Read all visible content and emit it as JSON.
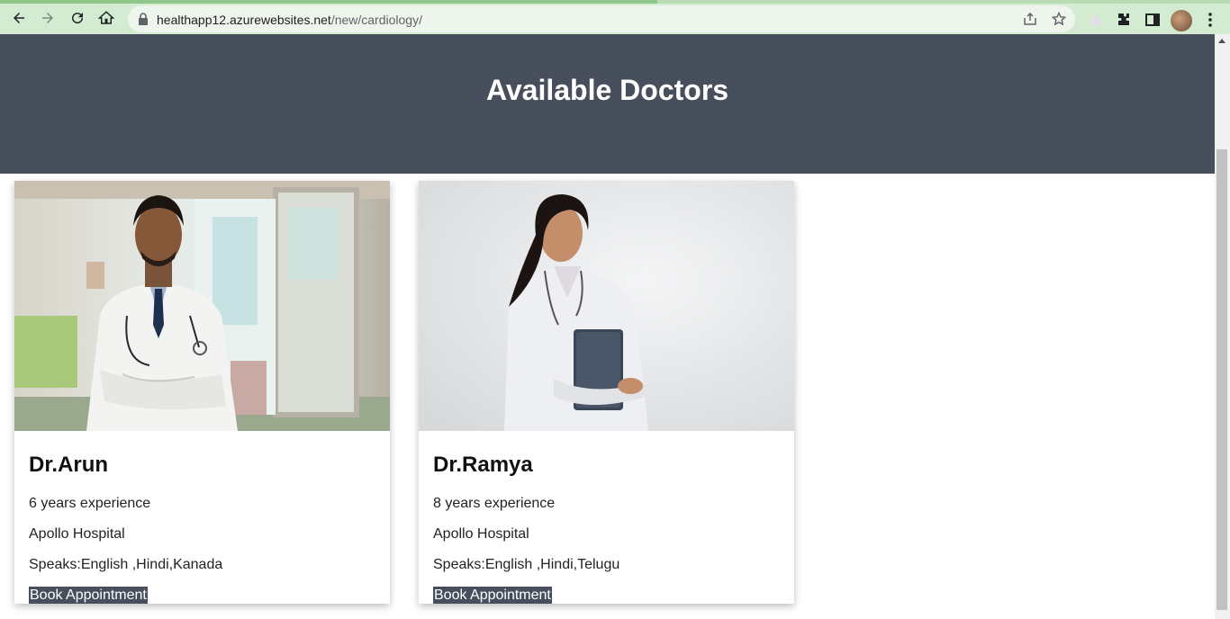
{
  "browser": {
    "url_host": "healthapp12.azurewebsites.net",
    "url_path": "/new/cardiology/"
  },
  "page": {
    "title": "Available Doctors"
  },
  "doctors": [
    {
      "name": "Dr.Arun",
      "experience": "6 years experience",
      "hospital": "Apollo Hospital",
      "languages": "Speaks:English ,Hindi,Kanada",
      "action": "Book Appointment"
    },
    {
      "name": "Dr.Ramya",
      "experience": "8 years experience",
      "hospital": "Apollo Hospital",
      "languages": "Speaks:English ,Hindi,Telugu",
      "action": "Book Appointment"
    }
  ],
  "colors": {
    "header_bg": "#484f5c",
    "chrome_bg": "#d3ebd0",
    "button_bg": "#484f5c"
  }
}
